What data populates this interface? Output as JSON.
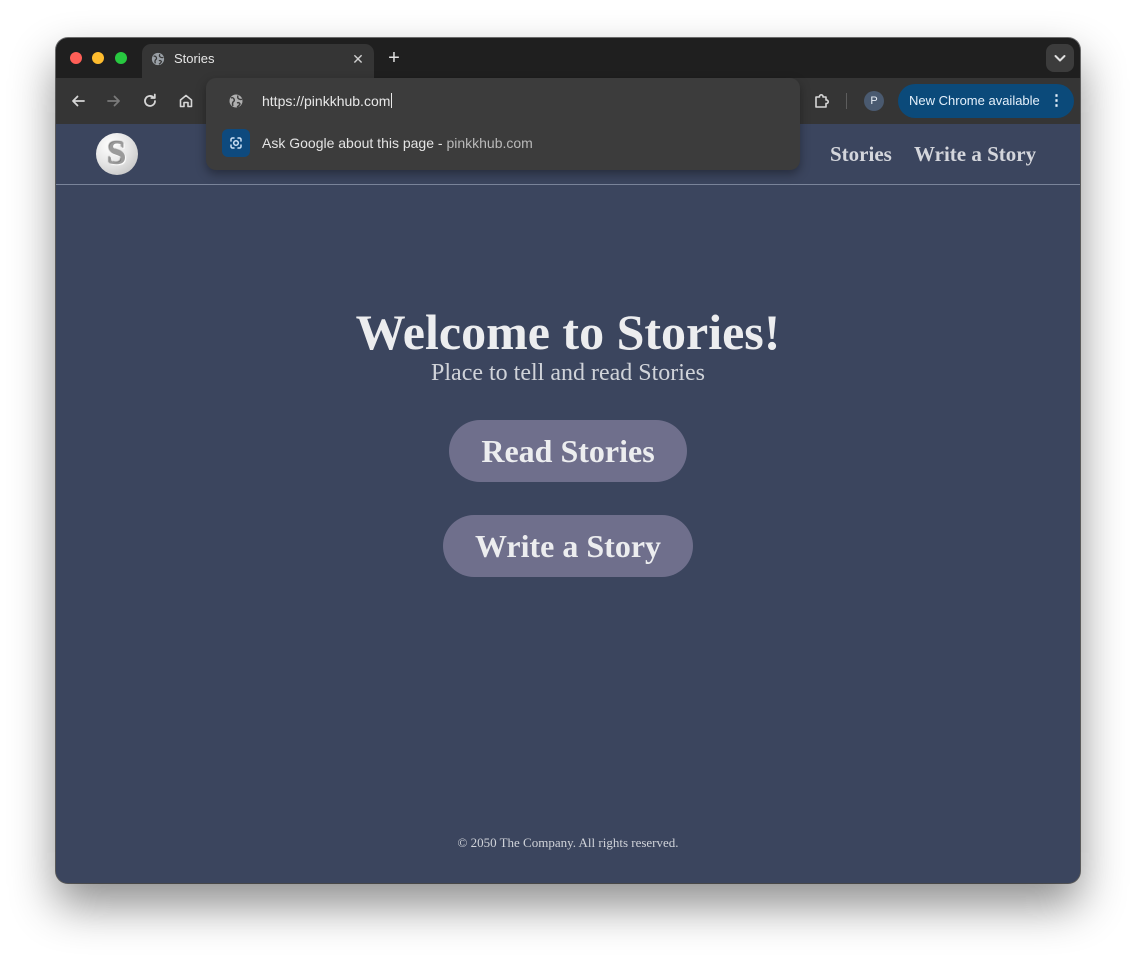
{
  "browser": {
    "tab": {
      "title": "Stories",
      "close_glyph": "✕",
      "favicon": "globe-icon"
    },
    "new_tab_glyph": "+",
    "omnibox": {
      "value": "https://pinkkhub.com",
      "suggestion": {
        "label": "Ask Google about this page - ",
        "url": "pinkkhub.com",
        "icon": "google-lens-icon"
      }
    },
    "profile_initial": "P",
    "update_button": {
      "label": "New Chrome available",
      "menu_glyph": "⋮"
    }
  },
  "site": {
    "logo_letter": "S",
    "nav": [
      {
        "label": "Stories"
      },
      {
        "label": "Write a Story"
      }
    ],
    "hero": {
      "title": "Welcome to Stories!",
      "subtitle": "Place to tell and read Stories"
    },
    "buttons": {
      "read": "Read Stories",
      "write": "Write a Story"
    },
    "footer": "© 2050 The Company. All rights reserved."
  },
  "colors": {
    "page_background": "#3b455e",
    "button_background": "#6f6f8c",
    "update_button": "#0b4a7a"
  }
}
